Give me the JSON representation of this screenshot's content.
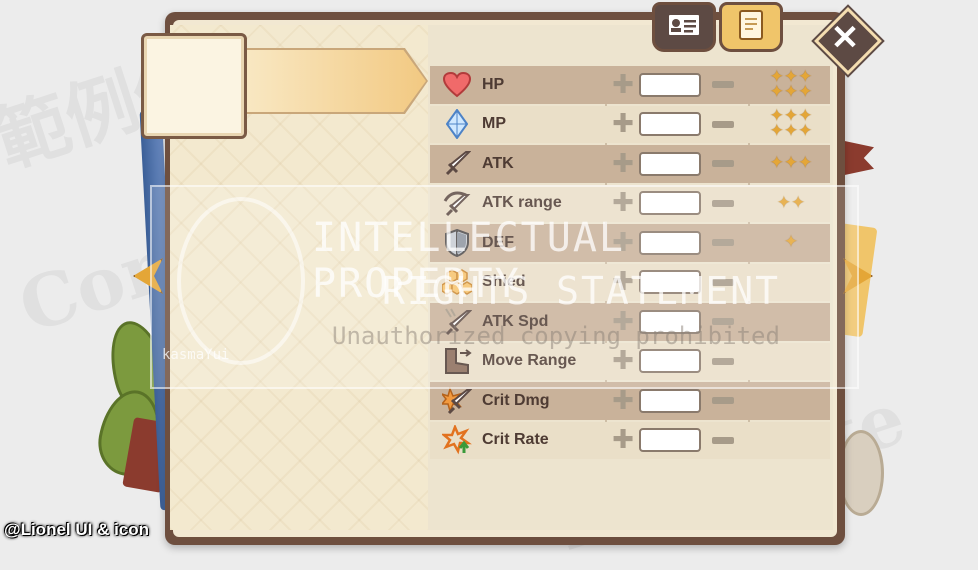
{
  "watermark": {
    "brand": "kasmaYui",
    "statement_line1": "INTELLECTUAL PROPERTY",
    "statement_line2": "RIGHTS STATEMENT",
    "statement_line3": "Unauthorized copying prohibited",
    "bg_text_1": "範例僅供",
    "bg_text_2": "Commission",
    "bg_text_3": "Template"
  },
  "credit": "@Lionel UI & icon",
  "close_label": "✕",
  "tabs": [
    {
      "name": "id-card",
      "icon": "id-card-icon"
    },
    {
      "name": "document",
      "icon": "document-icon"
    }
  ],
  "stats": [
    {
      "label": "HP",
      "icon": "heart-icon",
      "value": "",
      "stars": "✦✦✦\n✦✦✦"
    },
    {
      "label": "MP",
      "icon": "crystal-icon",
      "value": "",
      "stars": "✦✦✦\n✦✦✦"
    },
    {
      "label": "ATK",
      "icon": "sword-icon",
      "value": "",
      "stars": "✦✦✦"
    },
    {
      "label": "ATK range",
      "icon": "range-sword-icon",
      "value": "",
      "stars": "✦✦"
    },
    {
      "label": "DEF",
      "icon": "shield-icon",
      "value": "",
      "stars": "✦"
    },
    {
      "label": "Shied",
      "icon": "honeycomb-icon",
      "value": "",
      "stars": ""
    },
    {
      "label": "ATK Spd",
      "icon": "fast-sword-icon",
      "value": "",
      "stars": ""
    },
    {
      "label": "Move Range",
      "icon": "boot-icon",
      "value": "",
      "stars": ""
    },
    {
      "label": "Crit Dmg",
      "icon": "burst-sword-icon",
      "value": "",
      "stars": ""
    },
    {
      "label": "Crit Rate",
      "icon": "burst-up-icon",
      "value": "",
      "stars": ""
    }
  ]
}
